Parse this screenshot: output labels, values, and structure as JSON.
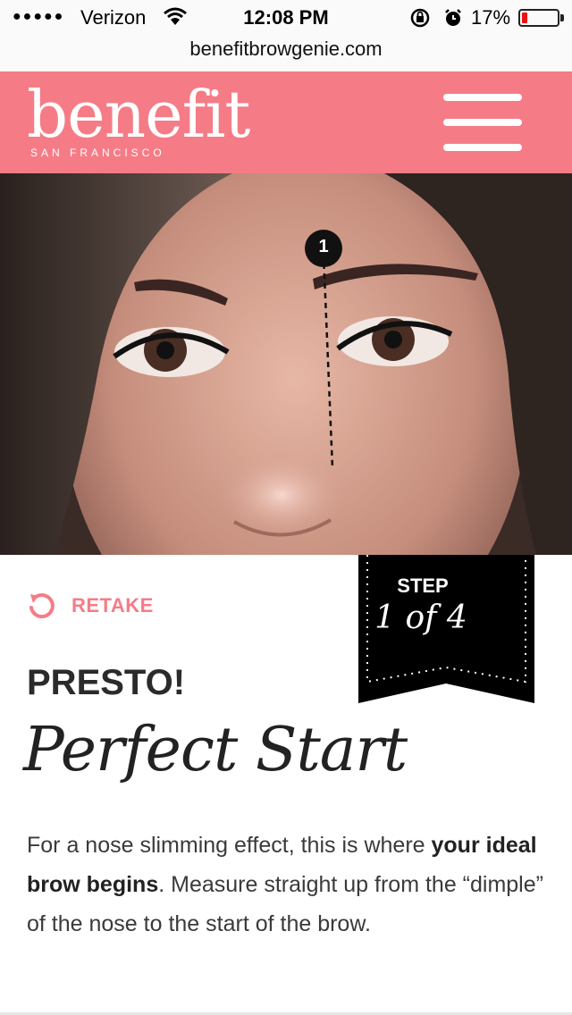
{
  "status_bar": {
    "signal_dots": "●●●●●",
    "carrier": "Verizon",
    "time": "12:08 PM",
    "battery_percent": "17%",
    "battery_level": 0.17,
    "icons": [
      "signal-dots",
      "wifi-icon",
      "rotation-lock-icon",
      "alarm-icon",
      "battery-icon"
    ]
  },
  "url_bar": {
    "url": "benefitbrowgenie.com"
  },
  "header": {
    "brand": "benefit",
    "brand_sub": "SAN FRANCISCO",
    "menu_icon": "hamburger-menu-icon",
    "color": "#f57c86"
  },
  "photo": {
    "marker_number": "1"
  },
  "retake": {
    "label": "RETAKE",
    "icon": "retake-icon"
  },
  "step_ribbon": {
    "step_label": "STEP",
    "step_count": "1 of 4"
  },
  "content": {
    "heading": "PRESTO!",
    "title": "Perfect Start",
    "desc_part1": "For a nose slimming effect, this is where ",
    "desc_bold": "your ideal brow begins",
    "desc_part2": ". Measure straight up from the “dimple” of the nose to the start of the brow."
  },
  "colors": {
    "accent": "#f57c86",
    "text": "#2b2b2b",
    "ribbon": "#000000"
  }
}
